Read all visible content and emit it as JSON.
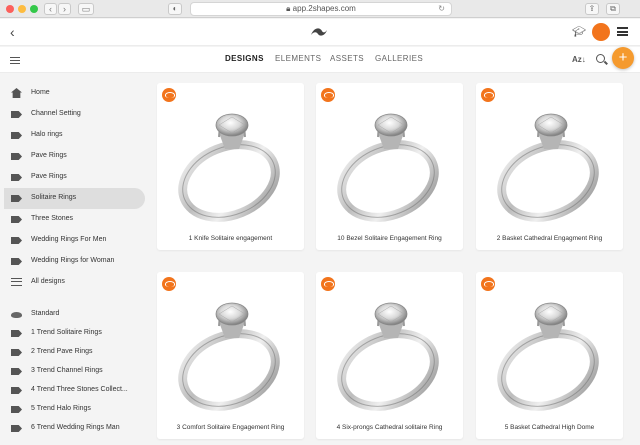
{
  "browser": {
    "url": "app.2shapes.com",
    "back_icon": "chevron-left-icon",
    "forward_icon": "chevron-right-icon"
  },
  "app": {
    "back_glyph": "‹",
    "tabs": [
      {
        "label": "DESIGNS",
        "active": true
      },
      {
        "label": "ELEMENTS",
        "active": false
      },
      {
        "label": "ASSETS",
        "active": false
      },
      {
        "label": "GALLERIES",
        "active": false
      }
    ],
    "sort_label": "Az↓",
    "add_glyph": "+",
    "accent_color": "#f2741c",
    "fab_color": "#f59a2e"
  },
  "sidebar": {
    "items": [
      {
        "label": "Home",
        "icon": "home-icon",
        "selected": false
      },
      {
        "label": "Channel Setting",
        "icon": "tag-icon",
        "selected": false
      },
      {
        "label": "Halo rings",
        "icon": "tag-icon",
        "selected": false
      },
      {
        "label": "Pave Rings",
        "icon": "tag-icon",
        "selected": false
      },
      {
        "label": "Pave Rings",
        "icon": "tag-icon",
        "selected": false
      },
      {
        "label": "Solitaire Rings",
        "icon": "tag-icon",
        "selected": true
      },
      {
        "label": "Three Stones",
        "icon": "tag-icon",
        "selected": false
      },
      {
        "label": "Wedding Rings For Men",
        "icon": "tag-icon",
        "selected": false
      },
      {
        "label": "Wedding Rings for Woman",
        "icon": "tag-icon",
        "selected": false
      },
      {
        "label": "All designs",
        "icon": "list-icon",
        "selected": false
      },
      {
        "label": "Standard",
        "icon": "cloud-icon",
        "selected": false
      },
      {
        "label": "1 Trend Solitaire Rings",
        "icon": "tag-icon",
        "selected": false
      },
      {
        "label": "2 Trend Pave Rings",
        "icon": "tag-icon",
        "selected": false
      },
      {
        "label": "3 Trend Channel Rings",
        "icon": "tag-icon",
        "selected": false
      },
      {
        "label": "4 Trend Three Stones Collect...",
        "icon": "tag-icon",
        "selected": false
      },
      {
        "label": "5 Trend Halo Rings",
        "icon": "tag-icon",
        "selected": false
      },
      {
        "label": "6 Trend Wedding Rings Man",
        "icon": "tag-icon",
        "selected": false
      }
    ]
  },
  "designs": [
    {
      "title": "1 Knife Solitaire engagement"
    },
    {
      "title": "10 Bezel Solitaire Engagement Ring"
    },
    {
      "title": "2 Basket Cathedral Engagment Ring"
    },
    {
      "title": "3 Comfort Solitaire Engagement Ring"
    },
    {
      "title": "4 Six-prongs Cathedral solitaire Ring"
    },
    {
      "title": "5 Basket Cathedral High Dome"
    }
  ]
}
